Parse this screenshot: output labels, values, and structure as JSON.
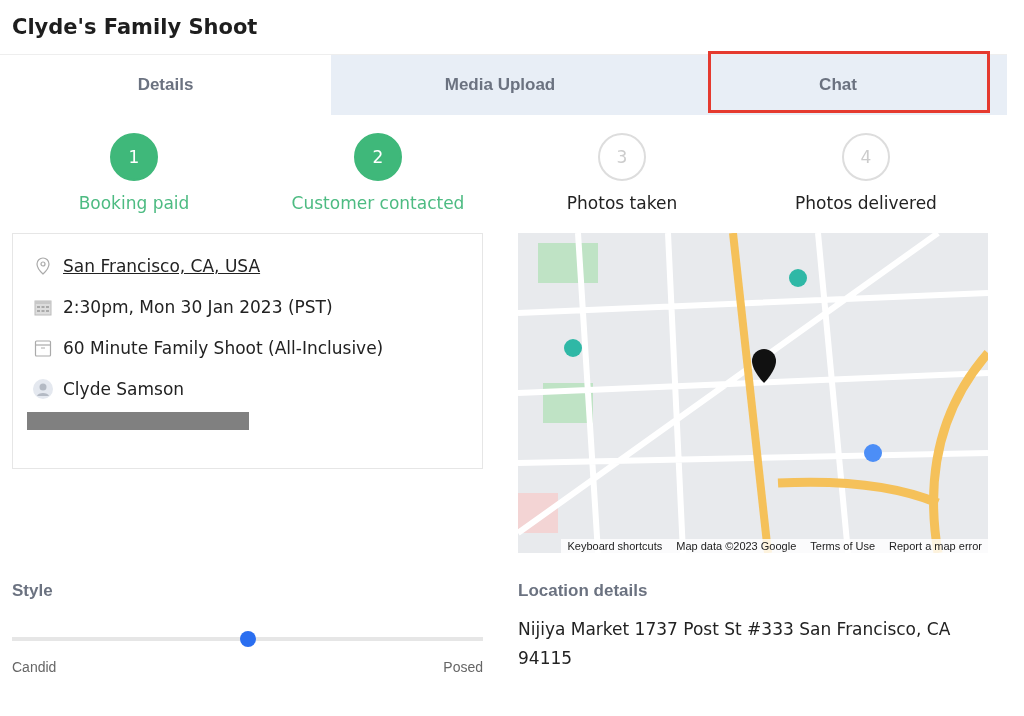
{
  "title": "Clyde's Family Shoot",
  "tabs": [
    {
      "label": "Details",
      "selected": true,
      "highlighted": false
    },
    {
      "label": "Media Upload",
      "selected": false,
      "highlighted": false
    },
    {
      "label": "Chat",
      "selected": false,
      "highlighted": true
    }
  ],
  "steps": [
    {
      "number": "1",
      "label": "Booking paid",
      "done": true
    },
    {
      "number": "2",
      "label": "Customer contacted",
      "done": true
    },
    {
      "number": "3",
      "label": "Photos taken",
      "done": false
    },
    {
      "number": "4",
      "label": "Photos delivered",
      "done": false
    }
  ],
  "details": [
    {
      "kind": "location",
      "text": "San Francisco, CA, USA"
    },
    {
      "kind": "date",
      "text": "2:30pm, Mon 30 Jan 2023 (PST)"
    },
    {
      "kind": "package",
      "text": "60 Minute Family Shoot (All-Inclusive)"
    },
    {
      "kind": "customer",
      "text": "Clyde Samson"
    },
    {
      "kind": "redacted"
    }
  ],
  "map": {
    "attribution": [
      "Keyboard shortcuts",
      "Map data ©2023 Google",
      "Terms of Use",
      "Report a map error"
    ]
  },
  "style": {
    "label": "Style",
    "level": 0.5,
    "min_label": "Candid",
    "max_label": "Posed"
  },
  "location_details": {
    "label": "Location details",
    "address": "Nijiya Market 1737 Post St #333 San Francisco, CA 94115"
  }
}
